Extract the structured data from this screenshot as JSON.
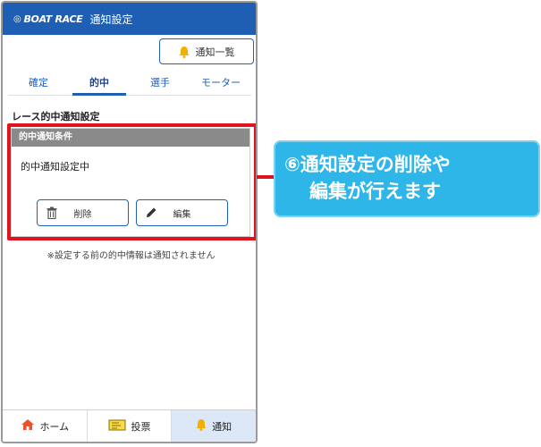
{
  "header": {
    "logo_text": "BOAT RACE",
    "title": "通知設定"
  },
  "notify_list_button": {
    "label": "通知一覧",
    "icon": "bell-icon"
  },
  "tabs": [
    {
      "label": "確定",
      "active": false
    },
    {
      "label": "的中",
      "active": true
    },
    {
      "label": "選手",
      "active": false
    },
    {
      "label": "モーター",
      "active": false
    }
  ],
  "section": {
    "title": "レース的中通知設定"
  },
  "condition": {
    "header": "的中通知条件",
    "status": "的中通知設定中",
    "delete_label": "削除",
    "edit_label": "編集"
  },
  "note": "※設定する前の的中情報は通知されません",
  "bottom_nav": [
    {
      "label": "ホーム",
      "icon": "home-icon",
      "active": false
    },
    {
      "label": "投票",
      "icon": "ticket-icon",
      "active": false
    },
    {
      "label": "通知",
      "icon": "bell-icon",
      "active": true
    }
  ],
  "callout": {
    "line1": "⑥通知設定の削除や",
    "line2": "編集が行えます"
  },
  "colors": {
    "brand_blue": "#1e5fb4",
    "highlight_red": "#e0141e",
    "callout_cyan": "#2fb6e8"
  }
}
